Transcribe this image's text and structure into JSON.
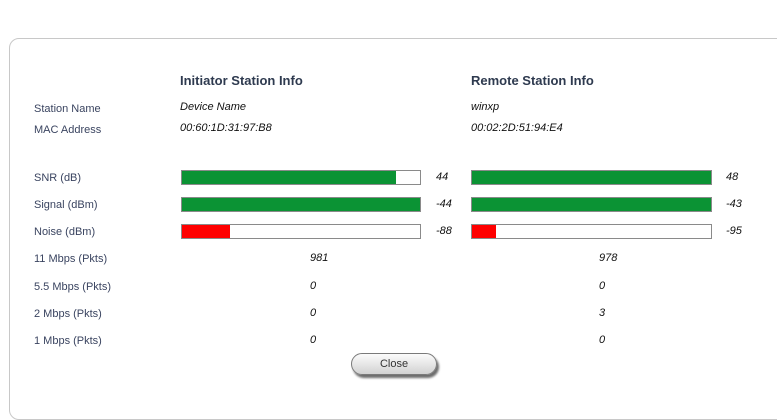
{
  "headers": {
    "initiator": "Initiator Station Info",
    "remote": "Remote Station Info"
  },
  "labels": {
    "station_name": "Station Name",
    "mac_address": "MAC Address",
    "snr": "SNR (dB)",
    "signal": "Signal (dBm)",
    "noise": "Noise (dBm)",
    "rate_11": "11 Mbps (Pkts)",
    "rate_5_5": "5.5 Mbps (Pkts)",
    "rate_2": "2 Mbps (Pkts)",
    "rate_1": "1 Mbps (Pkts)"
  },
  "initiator": {
    "station_name": "Device Name",
    "mac_address": "00:60:1D:31:97:B8",
    "snr": {
      "value": "44",
      "level": 0.9
    },
    "signal": {
      "value": "-44",
      "level": 1.0
    },
    "noise": {
      "value": "-88",
      "level": 0.2
    },
    "rate_11": "981",
    "rate_5_5": "0",
    "rate_2": "0",
    "rate_1": "0"
  },
  "remote": {
    "station_name": "winxp",
    "mac_address": "00:02:2D:51:94:E4",
    "snr": {
      "value": "48",
      "level": 1.0
    },
    "signal": {
      "value": "-43",
      "level": 1.0
    },
    "noise": {
      "value": "-95",
      "level": 0.1
    },
    "rate_11": "978",
    "rate_5_5": "0",
    "rate_2": "3",
    "rate_1": "0"
  },
  "colors": {
    "good_bar": "#0b9334",
    "bad_bar": "#ff0000"
  },
  "buttons": {
    "close": "Close"
  }
}
